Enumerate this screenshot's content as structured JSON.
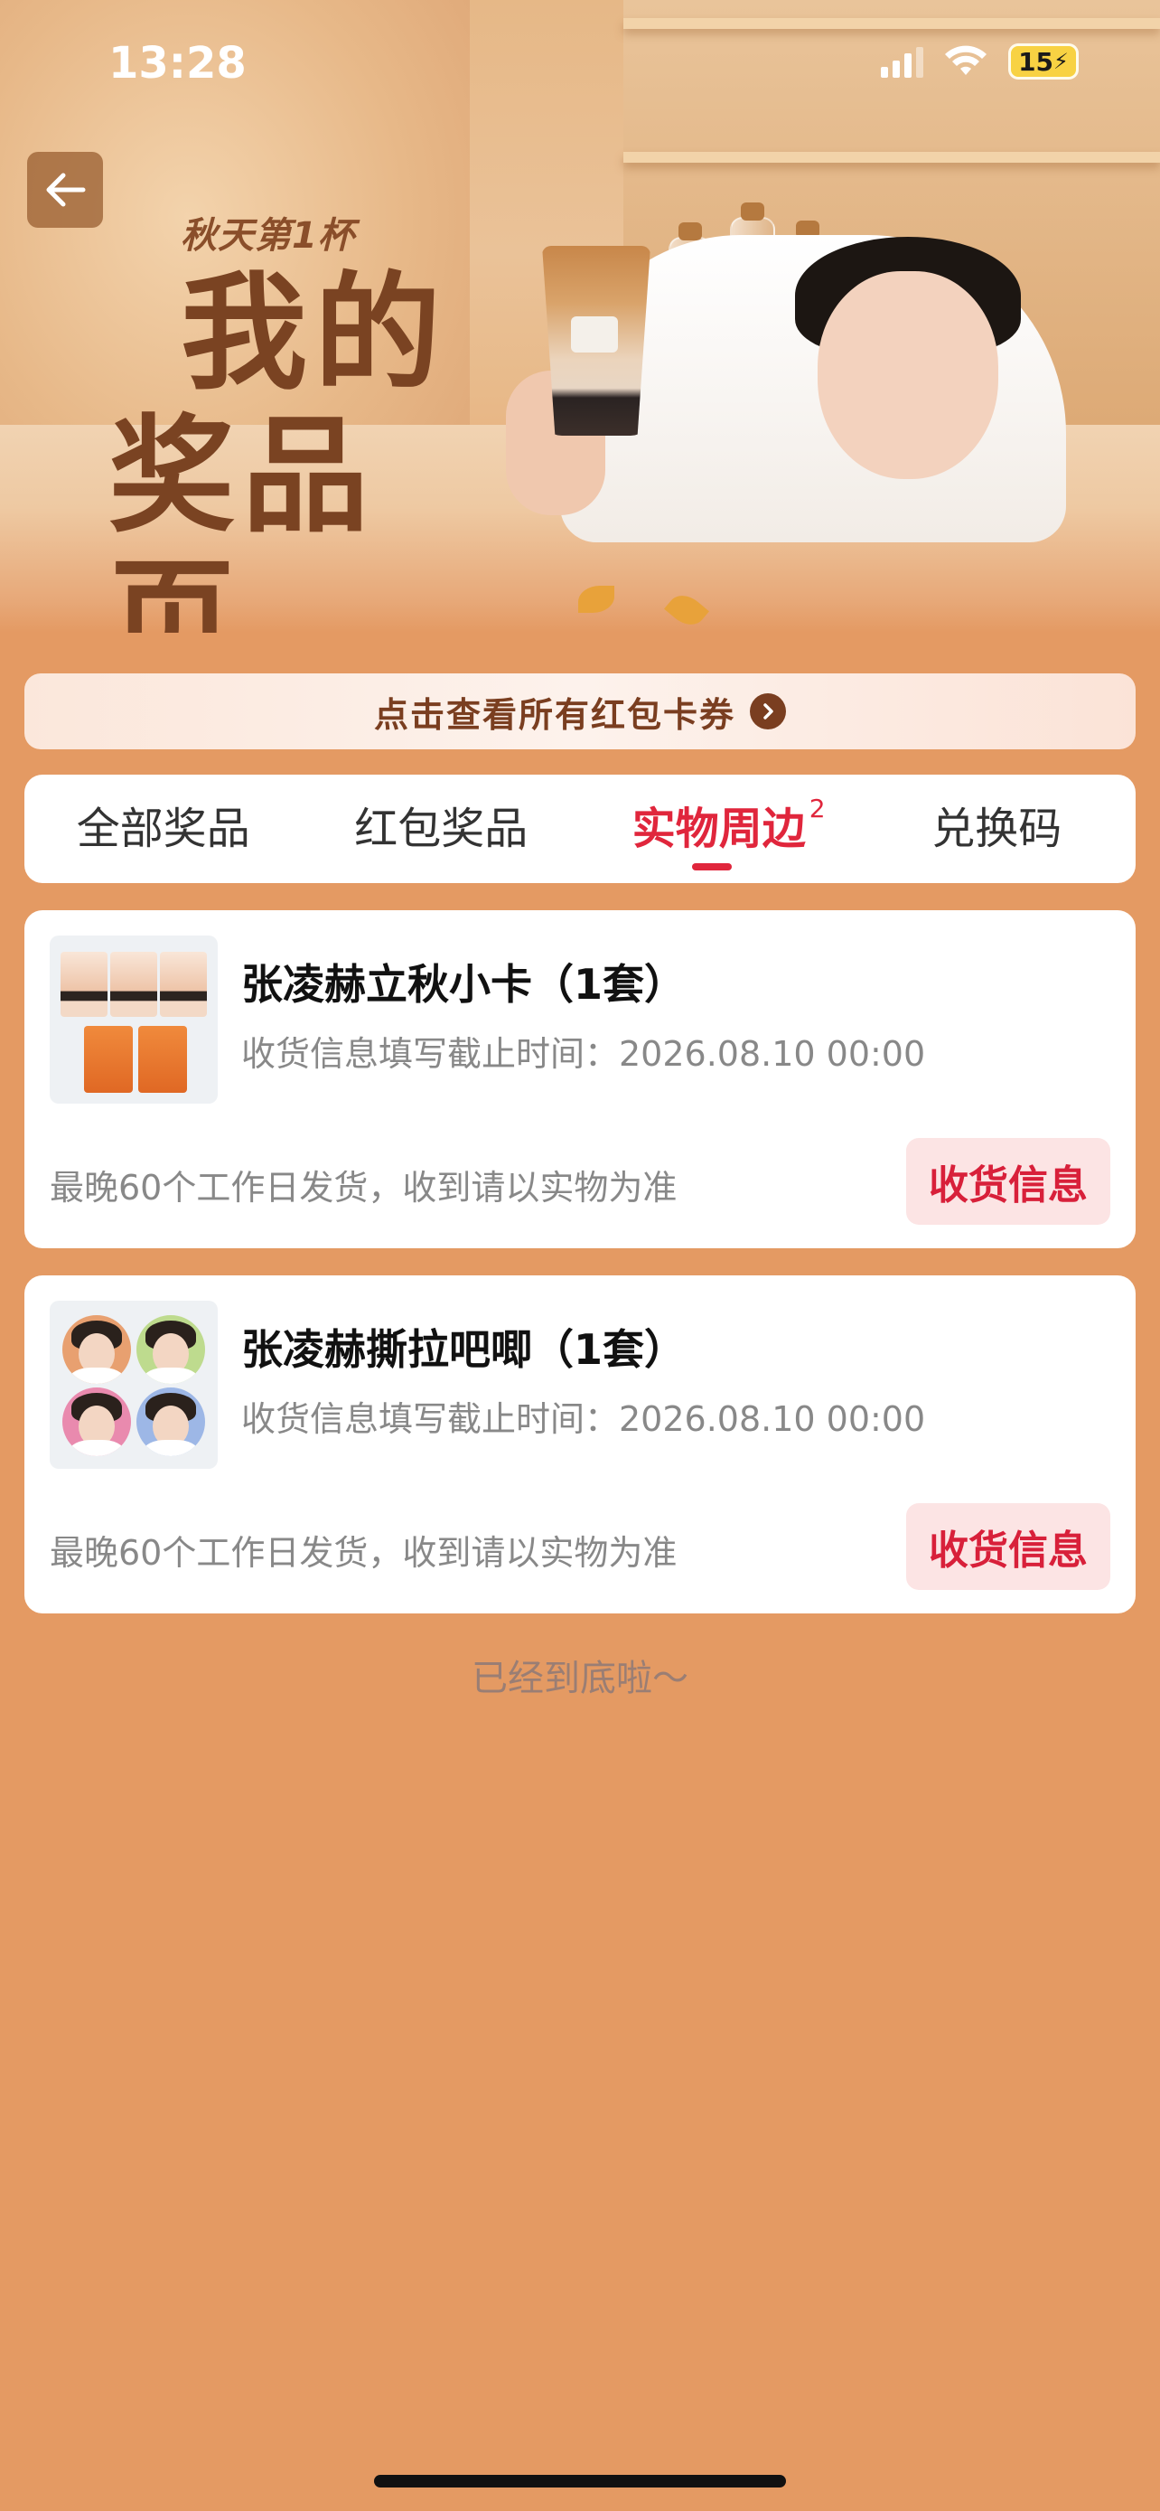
{
  "status_bar": {
    "time": "13:28",
    "battery": "15"
  },
  "hero": {
    "tag": "秋天第1杯",
    "title_line1": "我的",
    "title_line2": "奖品页"
  },
  "coupon_link": {
    "label": "点击查看所有红包卡券"
  },
  "tabs": [
    {
      "label": "全部奖品",
      "active": false
    },
    {
      "label": "红包奖品",
      "active": false
    },
    {
      "label": "实物周边",
      "active": true,
      "badge": "2"
    },
    {
      "label": "兑换码",
      "active": false
    }
  ],
  "prizes": [
    {
      "name": "张凌赫立秋小卡（1套）",
      "deadline": "收货信息填写截止时间：2026.08.10 00:00",
      "note": "最晚60个工作日发货，收到请以实物为准",
      "button": "收货信息"
    },
    {
      "name": "张凌赫撕拉吧唧（1套）",
      "deadline": "收货信息填写截止时间：2026.08.10 00:00",
      "note": "最晚60个工作日发货，收到请以实物为准",
      "button": "收货信息"
    }
  ],
  "footer": {
    "end_text": "已经到底啦～"
  },
  "colors": {
    "page_bg": "#E49A63",
    "accent_red": "#E0263C",
    "button_bg": "#FCE4E4",
    "coupon_text": "#7A3E20"
  }
}
